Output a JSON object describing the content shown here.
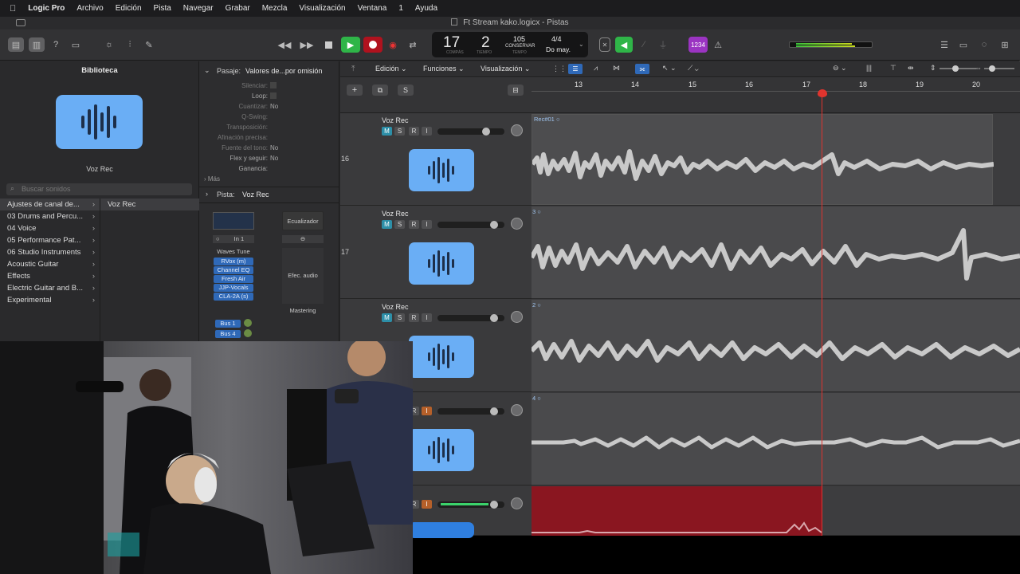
{
  "menubar": {
    "items": [
      "Logic Pro",
      "Archivo",
      "Edición",
      "Pista",
      "Navegar",
      "Grabar",
      "Mezcla",
      "Visualización",
      "Ventana",
      "1",
      "Ayuda"
    ]
  },
  "window": {
    "title": "Ft Stream kako.logicx - Pistas"
  },
  "lcd": {
    "bar": "17",
    "beat": "2",
    "bar_label": "COMPÁS",
    "beat_label": "TIEMPO",
    "tempo": "105",
    "tempo_mode": "CONSERVAR",
    "tempo_label": "TEMPO",
    "signature": "4/4",
    "key": "Do may."
  },
  "controls": {
    "count_in": "1234"
  },
  "library": {
    "title": "Biblioteca",
    "patch_name": "Voz Rec",
    "search_placeholder": "Buscar sonidos",
    "categories": [
      "Ajustes de canal de...",
      "03 Drums and Percu...",
      "04 Voice",
      "05 Performance Pat...",
      "06 Studio Instruments",
      "Acoustic Guitar",
      "Effects",
      "Electric Guitar and B...",
      "Experimental"
    ],
    "selected_patch": "Voz Rec"
  },
  "inspector": {
    "region_header_label": "Pasaje:",
    "region_header_value": "Valores de...por omisión",
    "rows": [
      {
        "label": "Silenciar:",
        "value": ""
      },
      {
        "label": "Loop:",
        "value": ""
      },
      {
        "label": "Cuantizar:",
        "value": "No"
      },
      {
        "label": "Q-Swing:",
        "value": ""
      },
      {
        "label": "Transposición:",
        "value": ""
      },
      {
        "label": "Afinación precisa:",
        "value": ""
      },
      {
        "label": "Fuente del tono:",
        "value": "No"
      },
      {
        "label": "Flex y seguir:",
        "value": "No"
      },
      {
        "label": "Ganancia:",
        "value": ""
      }
    ],
    "more": "Más",
    "track_header_label": "Pista:",
    "track_header_value": "Voz Rec",
    "eq_label": "Ecualizador",
    "input_label": "In 1",
    "plugins_header": "Waves Tune",
    "plugins": [
      "RVox (m)",
      "Channel EQ",
      "Fresh Air",
      "JJP-Vocals",
      "CLA-2A (s)"
    ],
    "audio_fx_label": "Efec. audio",
    "sends": [
      "Bus 1",
      "Bus 4"
    ],
    "mastering_label": "Mastering"
  },
  "tracks_toolbar": {
    "edit_menu": "Edición",
    "functions_menu": "Funciones",
    "view_menu": "Visualización"
  },
  "ruler": {
    "bars": [
      "13",
      "14",
      "15",
      "16",
      "17",
      "18",
      "19",
      "20"
    ]
  },
  "tracks": [
    {
      "number": "16",
      "name": "Voz Rec",
      "region": "Rec#01",
      "state": "normal"
    },
    {
      "number": "17",
      "name": "Voz Rec",
      "region": "3",
      "state": "normal"
    },
    {
      "number": "",
      "name": "Voz Rec",
      "region": "2",
      "state": "normal"
    },
    {
      "number": "",
      "name": "",
      "region": "4",
      "state": "normal"
    },
    {
      "number": "",
      "name": "",
      "region": "",
      "state": "recording"
    }
  ],
  "buttons": {
    "mute": "M",
    "solo": "S",
    "read": "R",
    "input": "I",
    "add": "+",
    "solo_global": "S"
  },
  "colors": {
    "accent_blue": "#6aaef5",
    "record_red": "#8a1620",
    "playhead": "#e0342e",
    "play_green": "#2fb548"
  }
}
